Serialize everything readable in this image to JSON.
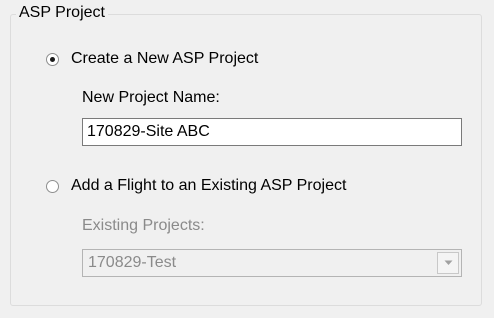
{
  "group": {
    "title": "ASP Project"
  },
  "option_new": {
    "label": "Create a New ASP Project",
    "selected": true
  },
  "new_project": {
    "label": "New Project Name:",
    "value": "170829-Site ABC"
  },
  "option_existing": {
    "label": "Add a Flight to an Existing ASP Project",
    "selected": false
  },
  "existing_projects": {
    "label": "Existing Projects:",
    "selected_value": "170829-Test",
    "enabled": false
  },
  "icons": {
    "dropdown": "chevron-down-icon"
  },
  "colors": {
    "background": "#f0f0f0",
    "disabled_text": "#8a8a8a",
    "group_border": "#dcdcdc"
  }
}
